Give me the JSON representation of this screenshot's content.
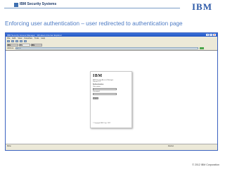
{
  "slide": {
    "brand": "IBM Security Systems",
    "logo": "IBM",
    "title": "Enforcing user authentication – user redirected to authentication page",
    "footer": "© 2012 IBM Corporation"
  },
  "browser": {
    "window_title": "IBM Security Access Manager - Windows Internet Explorer",
    "menu": [
      "File",
      "Edit",
      "View",
      "Favorites",
      "Tools",
      "Help"
    ],
    "tabs": [
      "IBM",
      "IBM",
      "IBM"
    ],
    "address_label": "Address",
    "address_value": "https://",
    "status_text": "Done",
    "status_zone": "Internet"
  },
  "login": {
    "logo": "IBM",
    "product": "IBM Security Access Manager",
    "version": "Version 7.0",
    "heading": "Authentication",
    "user_label": "User name",
    "password_label": "Password",
    "button": "Log in",
    "copyright": "© Copyright IBM Corp. 2012"
  }
}
